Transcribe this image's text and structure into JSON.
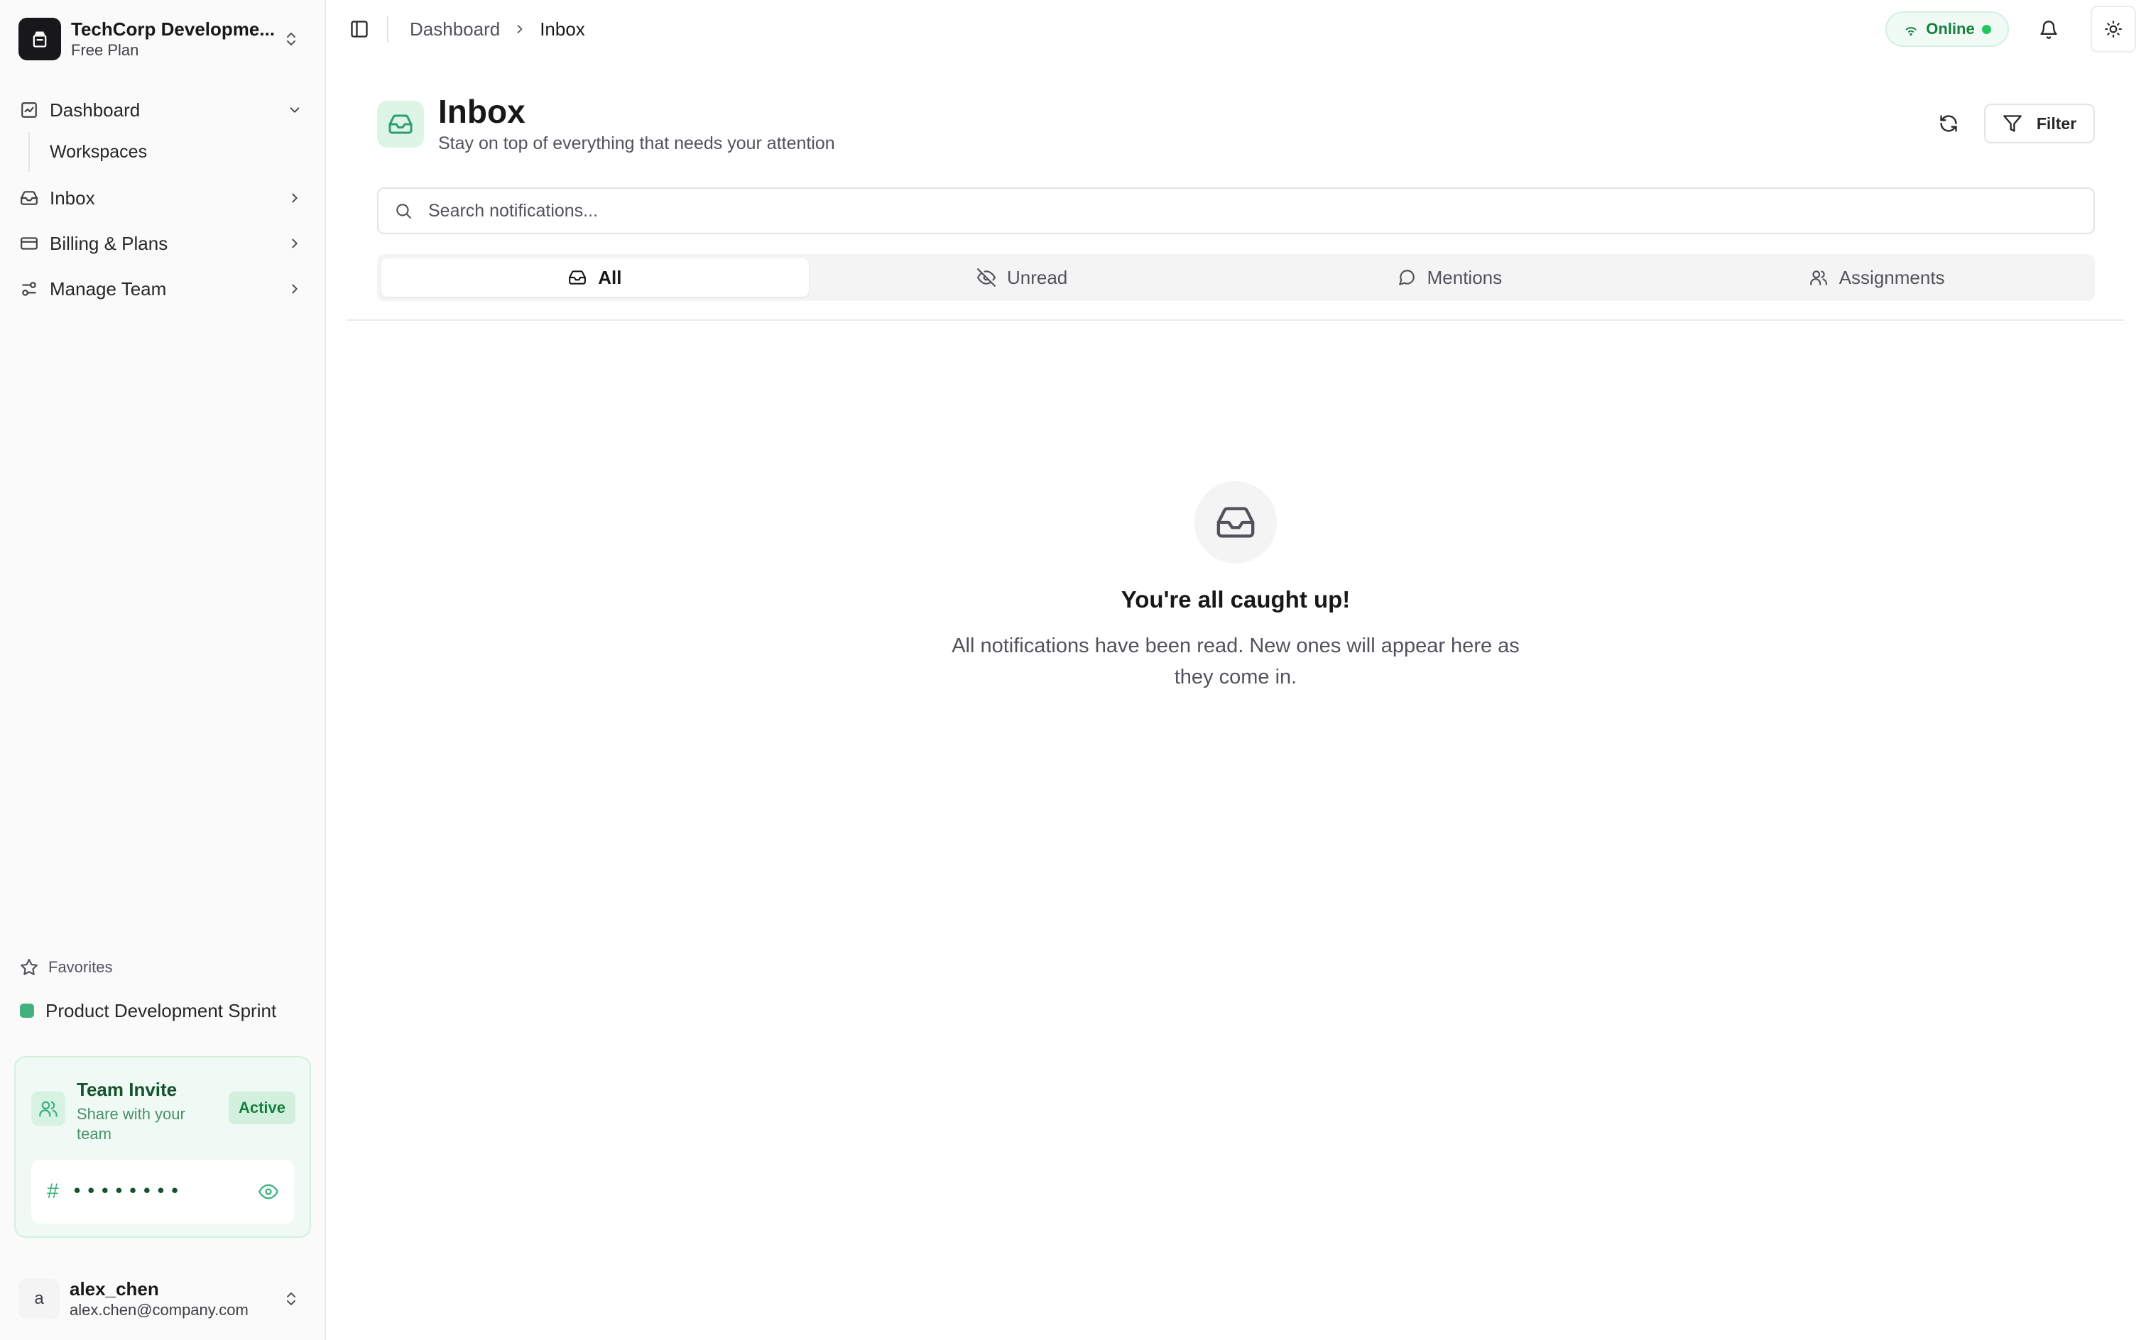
{
  "sidebar": {
    "org": {
      "name": "TechCorp Developme...",
      "plan": "Free Plan"
    },
    "nav": {
      "dashboard": "Dashboard",
      "workspaces": "Workspaces",
      "inbox": "Inbox",
      "billing": "Billing & Plans",
      "team": "Manage Team"
    },
    "favorites": {
      "header": "Favorites",
      "items": [
        {
          "label": "Product Development Sprint",
          "color": "#3fb27f"
        }
      ]
    },
    "invite": {
      "title": "Team Invite",
      "subtitle": "Share with your team",
      "badge": "Active",
      "hash": "#",
      "code_masked": "••••••••"
    },
    "user": {
      "avatar": "a",
      "name": "alex_chen",
      "email": "alex.chen@company.com"
    }
  },
  "topbar": {
    "breadcrumb": [
      "Dashboard",
      "Inbox"
    ],
    "status": "Online"
  },
  "page": {
    "title": "Inbox",
    "subtitle": "Stay on top of everything that needs your attention",
    "filter_label": "Filter"
  },
  "search": {
    "placeholder": "Search notifications...",
    "value": ""
  },
  "tabs": [
    {
      "label": "All",
      "icon": "inbox-icon",
      "active": true
    },
    {
      "label": "Unread",
      "icon": "eye-off-icon",
      "active": false
    },
    {
      "label": "Mentions",
      "icon": "message-circle-icon",
      "active": false
    },
    {
      "label": "Assignments",
      "icon": "users-icon",
      "active": false
    }
  ],
  "empty_state": {
    "title": "You're all caught up!",
    "description": "All notifications have been read. New ones will appear here as they come in."
  },
  "colors": {
    "accent": "#3fb27f",
    "online": "#22c55e",
    "accent_text": "#15803d"
  }
}
